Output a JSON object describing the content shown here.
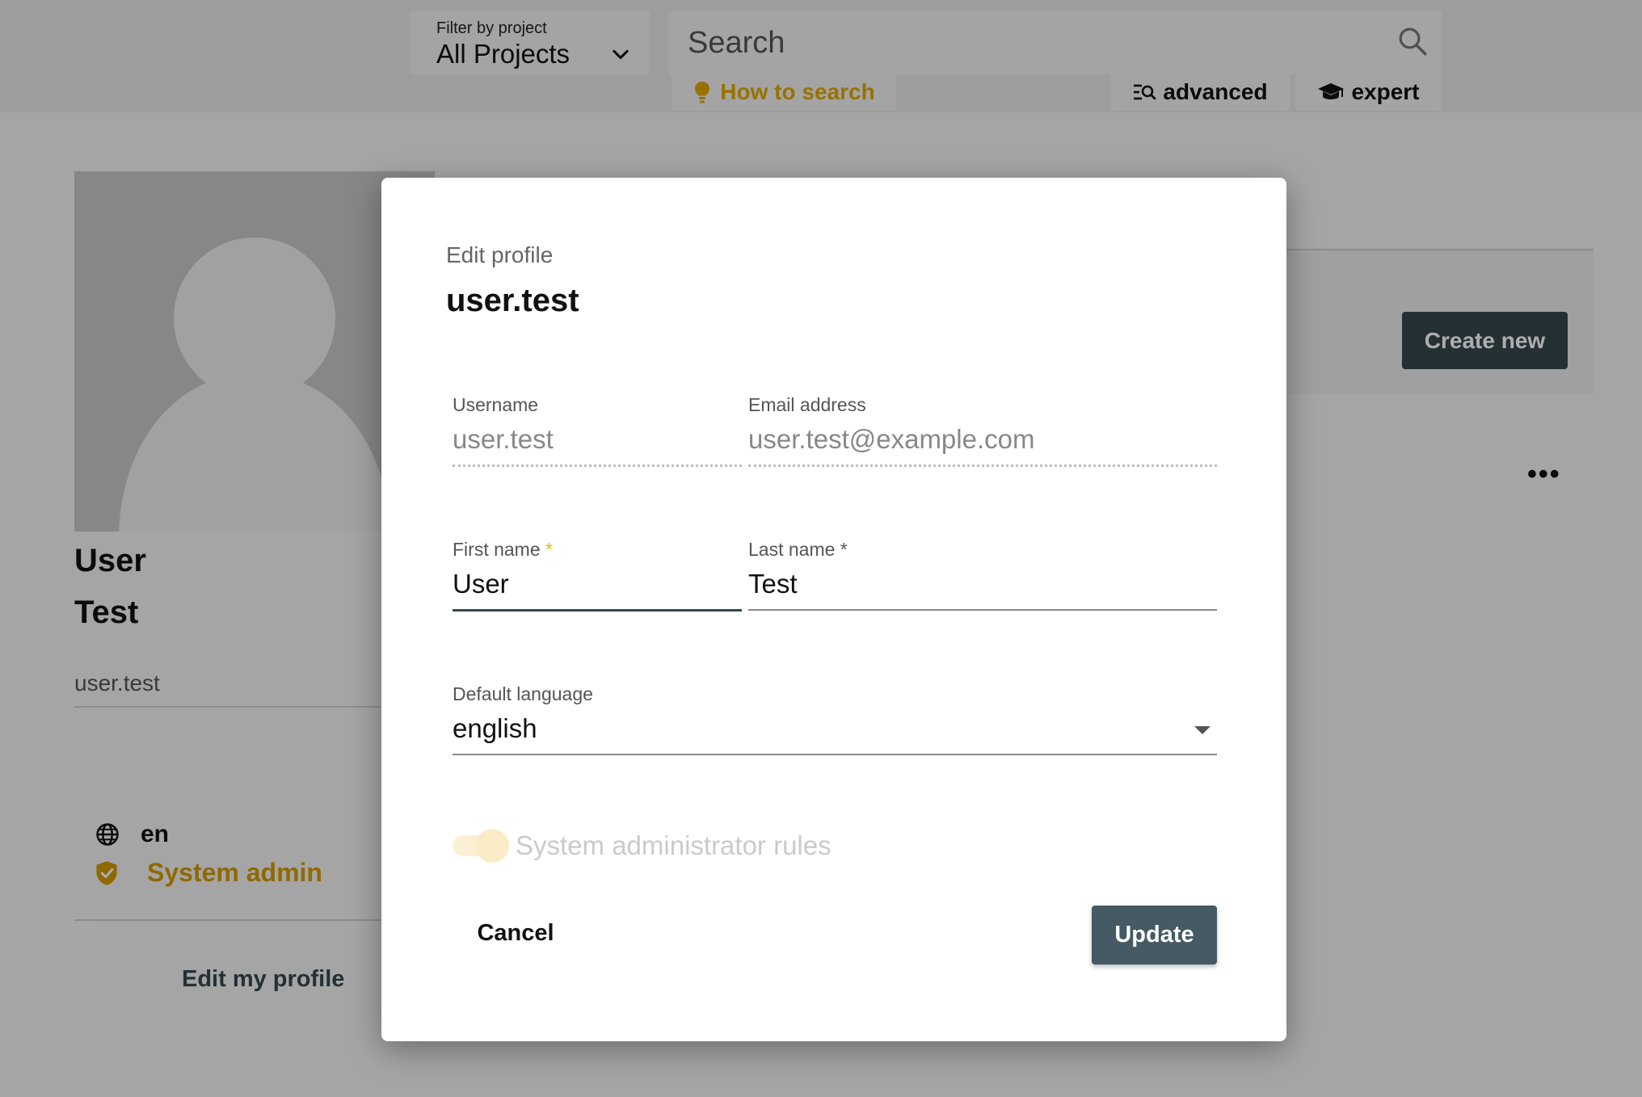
{
  "header": {
    "filter_caption": "Filter by project",
    "filter_value": "All Projects",
    "search_placeholder": "Search",
    "how_to_search": "How to search",
    "advanced": "advanced",
    "expert": "expert"
  },
  "profile": {
    "first_name": "User",
    "last_name": "Test",
    "username": "user.test",
    "language_code": "en",
    "role": "System admin",
    "edit_link": "Edit my profile"
  },
  "right_panel": {
    "create_new": "Create new"
  },
  "dialog": {
    "kicker": "Edit profile",
    "title": "user.test",
    "username_label": "Username",
    "username_value": "user.test",
    "email_label": "Email address",
    "email_value": "user.test@example.com",
    "first_name_label": "First name",
    "first_name_value": "User",
    "last_name_label": "Last name",
    "last_name_value": "Test",
    "required_mark": "*",
    "language_label": "Default language",
    "language_value": "english",
    "sysadmin_label": "System administrator rules",
    "cancel": "Cancel",
    "update": "Update"
  },
  "colors": {
    "accent_gold": "#e0a800",
    "primary_dark": "#37474f",
    "update_button": "#455a64"
  },
  "icons": {
    "filter_chevron": "chevron-down-icon",
    "search": "search-icon",
    "how_to_search": "lightbulb-icon",
    "advanced": "advanced-search-icon",
    "expert": "graduation-cap-icon",
    "language": "globe-icon",
    "role": "shield-check-icon",
    "more": "more-horizontal-icon",
    "language_select": "caret-down-icon"
  }
}
